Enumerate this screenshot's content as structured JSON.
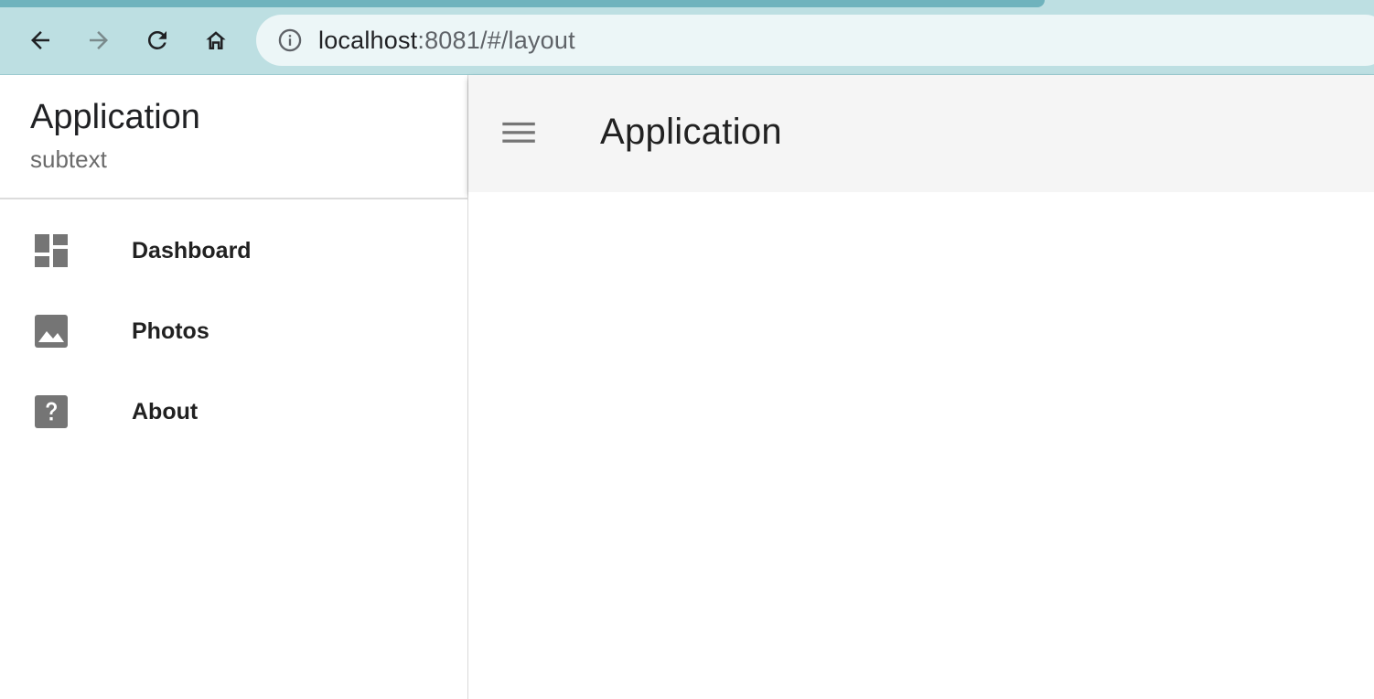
{
  "browser": {
    "url_host": "localhost",
    "url_rest": ":8081/#/layout"
  },
  "drawer": {
    "title": "Application",
    "subtitle": "subtext",
    "items": [
      {
        "label": "Dashboard",
        "icon": "dashboard-icon"
      },
      {
        "label": "Photos",
        "icon": "image-icon"
      },
      {
        "label": "About",
        "icon": "help-icon"
      }
    ]
  },
  "appbar": {
    "title": "Application"
  },
  "colors": {
    "browser_bar": "#bddfe2",
    "tab_strip": "#6fb3bd",
    "appbar_bg": "#f5f5f5",
    "icon_gray": "#757575"
  }
}
